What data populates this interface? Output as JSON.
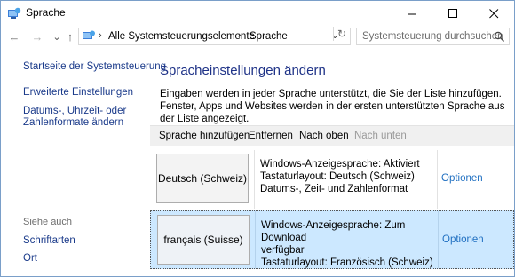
{
  "window": {
    "title": "Sprache",
    "minimize_glyph": "—",
    "maximize_glyph": "☐",
    "close_glyph": "✕"
  },
  "nav": {
    "back_glyph": "←",
    "forward_glyph": "→",
    "dropdown_glyph": "⌄",
    "up_glyph": "↑",
    "breadcrumb": [
      "Alle Systemsteuerungselemente",
      "Sprache"
    ],
    "separator": "›",
    "refresh_glyph": "↻",
    "search_placeholder": "Systemsteuerung durchsuchen"
  },
  "sidebar": {
    "home": "Startseite der Systemsteuerung",
    "advanced": "Erweiterte Einstellungen",
    "datetime_line1": "Datums-, Uhrzeit- oder",
    "datetime_line2": "Zahlenformate ändern",
    "see_also": "Siehe auch",
    "fonts": "Schriftarten",
    "location": "Ort"
  },
  "main": {
    "title": "Spracheinstellungen ändern",
    "description": "Eingaben werden in jeder Sprache unterstützt, die Sie der Liste hinzufügen. Fenster, Apps und Websites werden in der ersten unterstützten Sprache aus der Liste angezeigt."
  },
  "toolbar": {
    "add": "Sprache hinzufügen",
    "remove": "Entfernen",
    "move_up": "Nach oben",
    "move_down": "Nach unten"
  },
  "languages": [
    {
      "name": "Deutsch (Schweiz)",
      "line1": "Windows-Anzeigesprache: Aktiviert",
      "line2": "Tastaturlayout: Deutsch (Schweiz)",
      "line3": "Datums-, Zeit- und Zahlenformat",
      "options": "Optionen"
    },
    {
      "name": "français (Suisse)",
      "line1": "Windows-Anzeigesprache: Zum Download",
      "line2": "verfügbar",
      "line3": "Tastaturlayout: Französisch (Schweiz)",
      "options": "Optionen"
    }
  ],
  "colors": {
    "link": "#1a3a8a",
    "title": "#1e3287",
    "options": "#1f6fc1",
    "selection": "#cce8ff"
  }
}
